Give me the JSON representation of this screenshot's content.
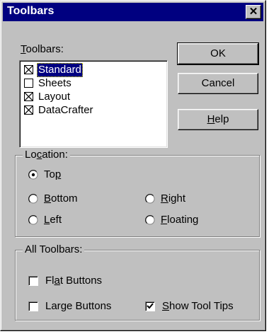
{
  "window": {
    "title": "Toolbars",
    "close_symbol": "✕"
  },
  "toolbars_label": "Toolbars:",
  "toolbars_label_mnemonic": "T",
  "toolbar_list": [
    {
      "label": "Standard",
      "checked": true,
      "selected": true
    },
    {
      "label": "Sheets",
      "checked": false,
      "selected": false
    },
    {
      "label": "Layout",
      "checked": true,
      "selected": false
    },
    {
      "label": "DataCrafter",
      "checked": true,
      "selected": false
    }
  ],
  "buttons": {
    "ok": "OK",
    "cancel": "Cancel",
    "help_rest": "elp",
    "help_mnemonic": "H"
  },
  "location": {
    "title_pre": "Lo",
    "title_mnemonic": "c",
    "title_post": "ation:",
    "options": {
      "top": {
        "pre": "To",
        "m": "p",
        "post": "",
        "selected": true
      },
      "bottom": {
        "pre": "",
        "m": "B",
        "post": "ottom",
        "selected": false
      },
      "left": {
        "pre": "",
        "m": "L",
        "post": "eft",
        "selected": false
      },
      "right": {
        "pre": "",
        "m": "R",
        "post": "ight",
        "selected": false
      },
      "floating": {
        "pre": "",
        "m": "F",
        "post": "loating",
        "selected": false
      }
    }
  },
  "all_toolbars": {
    "title": "All Toolbars:",
    "flat": {
      "pre": "Fl",
      "m": "a",
      "post": "t Buttons",
      "checked": false
    },
    "large": {
      "pre": "Lar",
      "m": "g",
      "post": "e Buttons",
      "checked": false
    },
    "tooltips": {
      "pre": "",
      "m": "S",
      "post": "how Tool Tips",
      "checked": true
    }
  }
}
